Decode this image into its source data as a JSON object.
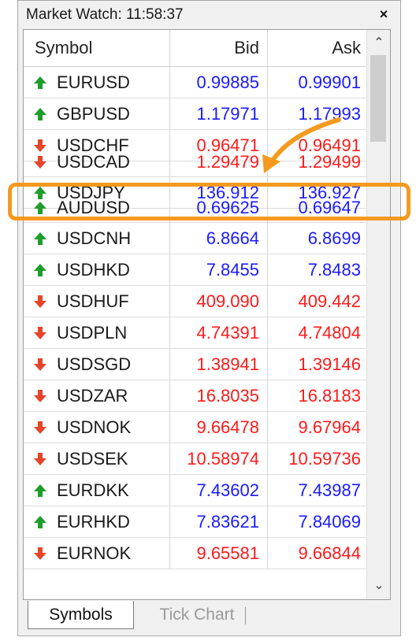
{
  "window": {
    "title": "Market Watch: 11:58:37",
    "close_label": "×"
  },
  "columns": {
    "symbol": "Symbol",
    "bid": "Bid",
    "ask": "Ask"
  },
  "colors": {
    "up": "#1a1aff",
    "down": "#ff1a1a",
    "up_arrow": "#1f9d2b",
    "down_arrow": "#e4452b",
    "highlight": "#f39a1f"
  },
  "rows": [
    {
      "symbol": "EURUSD",
      "bid": "0.99885",
      "ask": "0.99901",
      "dir": "up"
    },
    {
      "symbol": "GBPUSD",
      "bid": "1.17971",
      "ask": "1.17993",
      "dir": "up"
    },
    {
      "symbol": "USDCHF",
      "bid": "0.96471",
      "ask": "0.96491",
      "dir": "down"
    },
    {
      "symbol": "USDCAD",
      "bid": "1.29479",
      "ask": "1.29499",
      "dir": "down"
    }
  ],
  "highlighted_row": {
    "symbol": "USDJPY",
    "bid": "136.912",
    "ask": "136.927",
    "dir": "up"
  },
  "rows_after": [
    {
      "symbol": "AUDUSD",
      "bid": "0.69625",
      "ask": "0.69647",
      "dir": "up"
    },
    {
      "symbol": "USDCNH",
      "bid": "6.8664",
      "ask": "6.8699",
      "dir": "up"
    },
    {
      "symbol": "USDHKD",
      "bid": "7.8455",
      "ask": "7.8483",
      "dir": "up"
    },
    {
      "symbol": "USDHUF",
      "bid": "409.090",
      "ask": "409.442",
      "dir": "down"
    },
    {
      "symbol": "USDPLN",
      "bid": "4.74391",
      "ask": "4.74804",
      "dir": "down"
    },
    {
      "symbol": "USDSGD",
      "bid": "1.38941",
      "ask": "1.39146",
      "dir": "down"
    },
    {
      "symbol": "USDZAR",
      "bid": "16.8035",
      "ask": "16.8183",
      "dir": "down"
    },
    {
      "symbol": "USDNOK",
      "bid": "9.66478",
      "ask": "9.67964",
      "dir": "down"
    },
    {
      "symbol": "USDSEK",
      "bid": "10.58974",
      "ask": "10.59736",
      "dir": "down"
    },
    {
      "symbol": "EURDKK",
      "bid": "7.43602",
      "ask": "7.43987",
      "dir": "up"
    },
    {
      "symbol": "EURHKD",
      "bid": "7.83621",
      "ask": "7.84069",
      "dir": "up"
    },
    {
      "symbol": "EURNOK",
      "bid": "9.65581",
      "ask": "9.66844",
      "dir": "down"
    }
  ],
  "tabs": {
    "active": "Symbols",
    "inactive": "Tick Chart"
  }
}
